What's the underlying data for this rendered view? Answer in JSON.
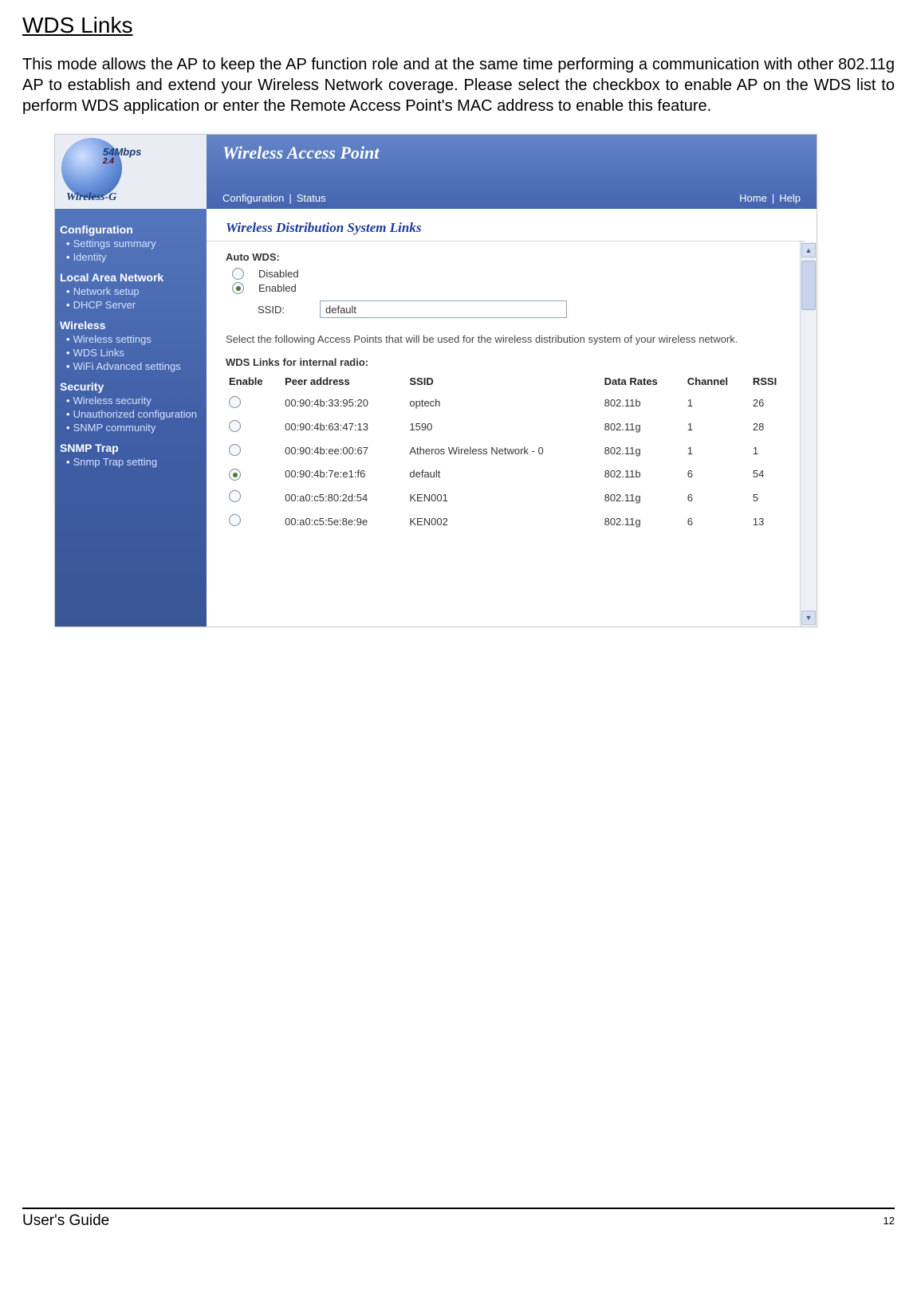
{
  "heading": "WDS Links",
  "intro": "This mode allows the AP to keep the AP function role and at the same time performing a communication with other 802.11g AP to establish and extend your Wireless Network coverage. Please select the checkbox to enable AP on the WDS list to perform WDS application or enter the Remote Access Point's MAC address to enable this feature.",
  "brand": {
    "rate": "54Mbps",
    "band": "2.4",
    "line": "Wireless-G"
  },
  "sidebar": {
    "groups": [
      {
        "title": "Configuration",
        "items": [
          "Settings summary",
          "Identity"
        ]
      },
      {
        "title": "Local Area Network",
        "items": [
          "Network setup",
          "DHCP Server"
        ]
      },
      {
        "title": "Wireless",
        "items": [
          "Wireless settings",
          "WDS Links",
          "WiFi Advanced settings"
        ]
      },
      {
        "title": "Security",
        "items": [
          "Wireless security",
          "Unauthorized configuration",
          "SNMP community"
        ]
      },
      {
        "title": "SNMP Trap",
        "items": [
          "Snmp Trap setting"
        ]
      }
    ]
  },
  "header": {
    "title": "Wireless Access Point",
    "tabs_left": [
      "Configuration",
      "Status"
    ],
    "tabs_right": [
      "Home",
      "Help"
    ],
    "sep": "|"
  },
  "section_title": "Wireless Distribution System Links",
  "auto_wds": {
    "label": "Auto WDS:",
    "options": [
      "Disabled",
      "Enabled"
    ],
    "selected": 1,
    "ssid_label": "SSID:",
    "ssid_value": "default"
  },
  "note": "Select the following Access Points that will be used for the wireless distribution system of your wireless network.",
  "table": {
    "title": "WDS Links for internal radio:",
    "cols": [
      "Enable",
      "Peer address",
      "SSID",
      "Data Rates",
      "Channel",
      "RSSI"
    ],
    "rows": [
      {
        "sel": false,
        "peer": "00:90:4b:33:95:20",
        "ssid": "optech",
        "rate": "802.11b",
        "ch": "1",
        "rssi": "26"
      },
      {
        "sel": false,
        "peer": "00:90:4b:63:47:13",
        "ssid": "1590",
        "rate": "802.11g",
        "ch": "1",
        "rssi": "28"
      },
      {
        "sel": false,
        "peer": "00:90:4b:ee:00:67",
        "ssid": "Atheros Wireless Network - 0",
        "rate": "802.11g",
        "ch": "1",
        "rssi": "1"
      },
      {
        "sel": true,
        "peer": "00:90:4b:7e:e1:f6",
        "ssid": "default",
        "rate": "802.11b",
        "ch": "6",
        "rssi": "54"
      },
      {
        "sel": false,
        "peer": "00:a0:c5:80:2d:54",
        "ssid": "KEN001",
        "rate": "802.11g",
        "ch": "6",
        "rssi": "5"
      },
      {
        "sel": false,
        "peer": "00:a0:c5:5e:8e:9e",
        "ssid": "KEN002",
        "rate": "802.11g",
        "ch": "6",
        "rssi": "13"
      }
    ]
  },
  "footer": {
    "left": "User's Guide",
    "right": "12"
  }
}
